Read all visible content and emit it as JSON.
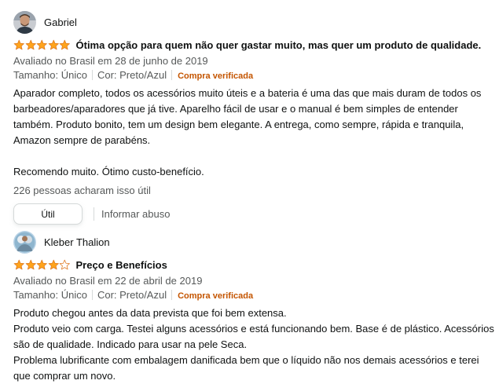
{
  "colors": {
    "star_fill": "#ffa41c",
    "star_empty": "#ffffff",
    "star_stroke": "#de7921",
    "verified": "#c45500",
    "muted_text": "#565959"
  },
  "reviews": [
    {
      "reviewer": "Gabriel",
      "avatar_icon": "user-photo-avatar",
      "rating": 5,
      "rating_max": 5,
      "title": "Ótima opção para quem não quer gastar muito, mas quer um produto de qualidade.",
      "date": "Avaliado no Brasil em 28 de junho de 2019",
      "size": "Tamanho: Único",
      "color": "Cor: Preto/Azul",
      "verified": "Compra verificada",
      "body": [
        "Aparador completo, todos os acessórios muito úteis e a bateria é uma das que mais duram de todos os barbeadores/aparadores que já tive. Aparelho fácil de usar e o manual é bem simples de entender também. Produto bonito, tem um design bem elegante. A entrega, como sempre, rápida e tranquila, Amazon sempre de parabéns.",
        "",
        "Recomendo muito. Ótimo custo-benefício."
      ],
      "helpful": "226 pessoas acharam isso útil",
      "useful_button": "Útil",
      "report_link": "Informar abuso"
    },
    {
      "reviewer": "Kleber Thalion",
      "avatar_icon": "user-photo-avatar",
      "rating": 4,
      "rating_max": 5,
      "title": "Preço e Benefícios",
      "date": "Avaliado no Brasil em 22 de abril de 2019",
      "size": "Tamanho: Único",
      "color": "Cor: Preto/Azul",
      "verified": "Compra verificada",
      "body": [
        "Produto chegou antes da data prevista que foi bem extensa.",
        "Produto veio com carga. Testei alguns acessórios e está funcionando bem. Base é de plástico. Acessórios são de qualidade. Indicado para usar na pele Seca.",
        "Problema lubrificante com embalagem danificada bem que o líquido não nos demais acessórios e terei que comprar um novo."
      ]
    }
  ]
}
